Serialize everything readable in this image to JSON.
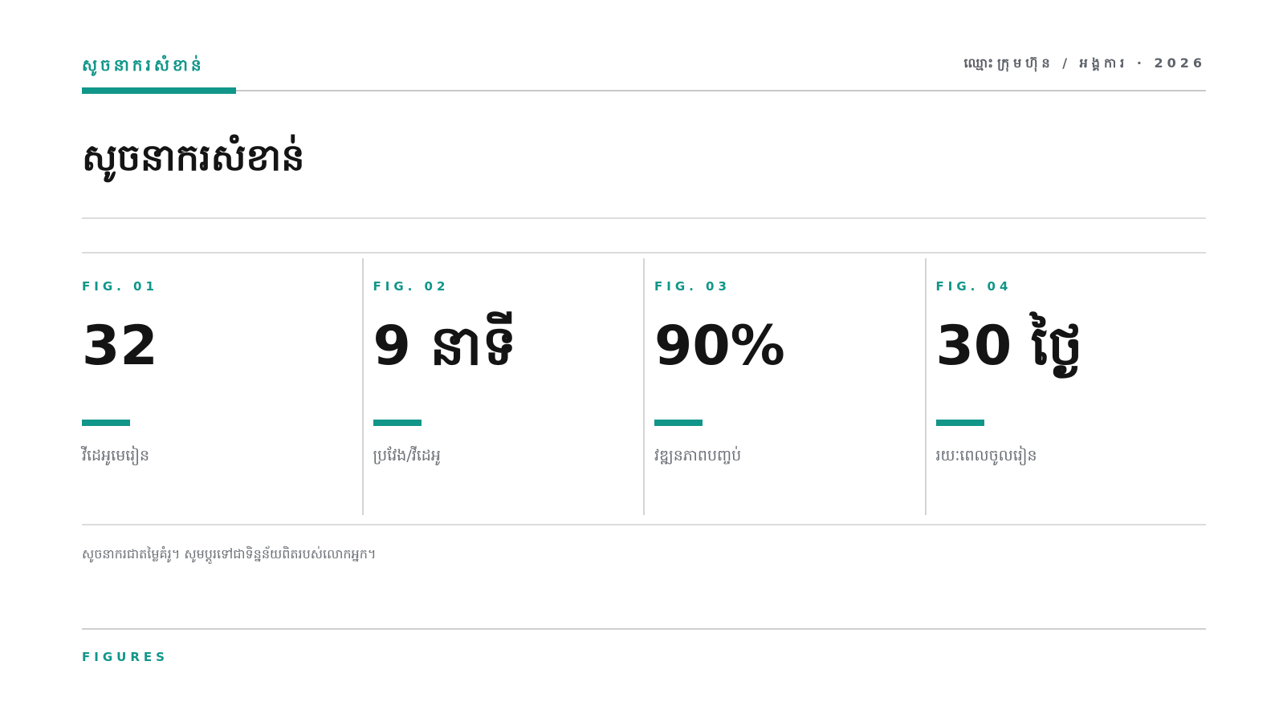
{
  "colors": {
    "accent": "#11968a",
    "text": "#141414",
    "muted": "#6b7077"
  },
  "header": {
    "kicker": "សូចនាករសំខាន់",
    "meta": "ឈ្មោះក្រុមហ៊ុន / អង្គការ · 2026"
  },
  "title": "សូចនាករសំខាន់",
  "stats": [
    {
      "fig": "FIG. 01",
      "value": "32",
      "caption": "វីដេអូមេរៀន"
    },
    {
      "fig": "FIG. 02",
      "value": "9 នាទី",
      "caption": "ប្រវែង/វីដេអូ"
    },
    {
      "fig": "FIG. 03",
      "value": "90%",
      "caption": "វឌ្ឍនភាពបញ្ចប់"
    },
    {
      "fig": "FIG. 04",
      "value": "30 ថ្ងៃ",
      "caption": "រយៈពេលចូលរៀន"
    }
  ],
  "note": "សូចនាករជាតម្លៃគំរូ។ សូមប្តូរទៅជាទិន្នន័យពិតរបស់លោកអ្នក។",
  "footer": "FIGURES"
}
